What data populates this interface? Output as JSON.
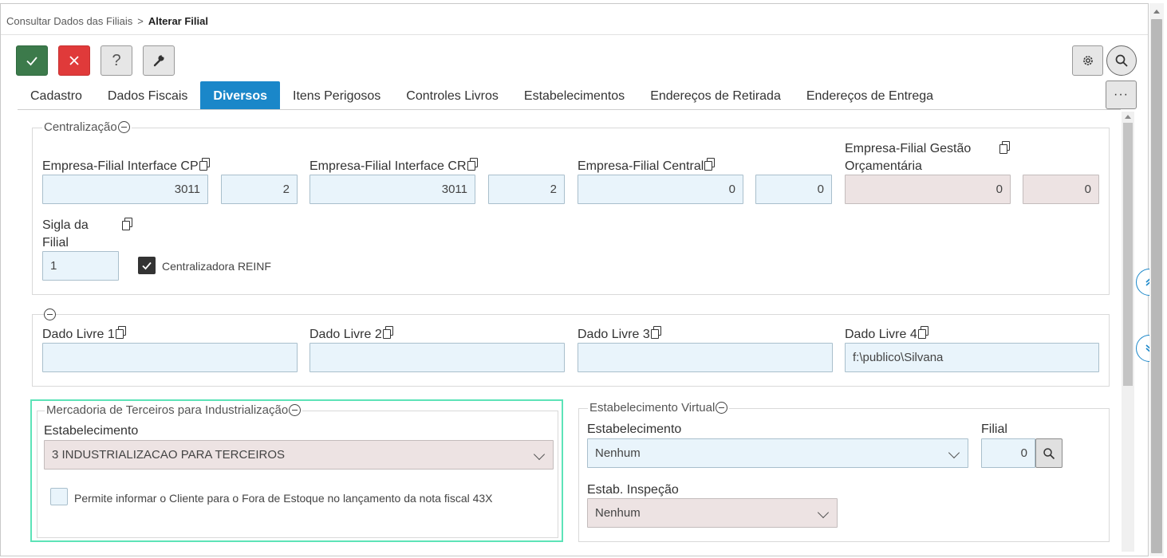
{
  "breadcrumb": {
    "parent": "Consultar Dados das Filiais",
    "separator": ">",
    "current": "Alterar Filial"
  },
  "toolbar": {
    "confirm_icon": "check-icon",
    "cancel_icon": "close-icon",
    "help_label": "?",
    "tools_icon": "wrench-icon",
    "settings_icon": "gear-icon",
    "search_icon": "search-icon",
    "more_label": "···"
  },
  "tabs": [
    {
      "label": "Cadastro"
    },
    {
      "label": "Dados Fiscais"
    },
    {
      "label": "Diversos",
      "active": true
    },
    {
      "label": "Itens Perigosos"
    },
    {
      "label": "Controles Livros"
    },
    {
      "label": "Estabelecimentos"
    },
    {
      "label": "Endereços de Retirada"
    },
    {
      "label": "Endereços de Entrega"
    }
  ],
  "centralizacao": {
    "legend": "Centralização",
    "empresa_filial_cp": {
      "label": "Empresa-Filial Interface CP",
      "empresa": "3011",
      "filial": "2"
    },
    "empresa_filial_cr": {
      "label": "Empresa-Filial Interface CR",
      "empresa": "3011",
      "filial": "2"
    },
    "empresa_filial_central": {
      "label": "Empresa-Filial Central",
      "empresa": "0",
      "filial": "0"
    },
    "empresa_filial_gestao": {
      "label_line1": "Empresa-Filial Gestão",
      "label_line2": "Orçamentária",
      "empresa": "0",
      "filial": "0"
    },
    "sigla": {
      "label_line1": "Sigla da",
      "label_line2": "Filial",
      "value": "1"
    },
    "centralizadora_reinf": {
      "label": "Centralizadora REINF",
      "checked": true
    }
  },
  "dados_livres": [
    {
      "label": "Dado Livre 1",
      "value": ""
    },
    {
      "label": "Dado Livre 2",
      "value": ""
    },
    {
      "label": "Dado Livre 3",
      "value": ""
    },
    {
      "label": "Dado Livre 4",
      "value": "f:\\publico\\Silvana"
    }
  ],
  "mercadoria_terceiros": {
    "legend": "Mercadoria de Terceiros para Industrialização",
    "estabelecimento_label": "Estabelecimento",
    "estabelecimento_value": "3 INDUSTRIALIZACAO PARA TERCEIROS",
    "permite_label": "Permite informar o Cliente para o Fora de Estoque no lançamento da nota fiscal 43X",
    "permite_checked": false
  },
  "estabelecimento_virtual": {
    "legend": "Estabelecimento Virtual",
    "estabelecimento_label": "Estabelecimento",
    "estabelecimento_value": "Nenhum",
    "filial_label": "Filial",
    "filial_value": "0",
    "inspecao_label": "Estab. Inspeção",
    "inspecao_value": "Nenhum"
  },
  "colors": {
    "accent": "#1a87c9",
    "confirm": "#3c7a4b",
    "cancel": "#e03a3a",
    "input_bg": "#e9f4fb",
    "disabled_bg": "#ede3e3",
    "highlight": "#5de3b8"
  }
}
